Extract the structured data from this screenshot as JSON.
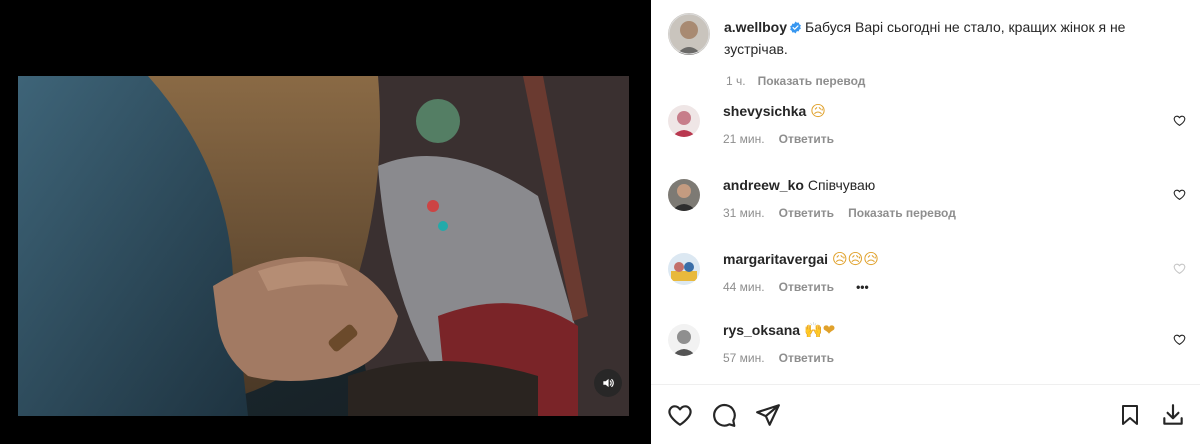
{
  "post": {
    "username": "a.wellboy",
    "caption": "Бабуся Варі сьогодні не стало, кращих жінок я не зустрічав.",
    "time": "1 ч.",
    "translate_label": "Показать перевод"
  },
  "comments": [
    {
      "username": "shevysichka",
      "text": "",
      "emoji": "😥",
      "time": "21 мин.",
      "reply_label": "Ответить"
    },
    {
      "username": "andreew_ko",
      "text": "Співчуваю",
      "emoji": "",
      "time": "31 мин.",
      "reply_label": "Ответить",
      "translate_label": "Показать перевод"
    },
    {
      "username": "margaritavergai",
      "text": "",
      "emoji": "😥😥😥",
      "time": "44 мин.",
      "reply_label": "Ответить",
      "more_label": "•••"
    },
    {
      "username": "rys_oksana",
      "text": "",
      "emoji": "🙌❤",
      "time": "57 мин.",
      "reply_label": "Ответить"
    }
  ],
  "icons": {
    "like": "heart-icon",
    "comment": "comment-icon",
    "share": "share-icon",
    "save": "bookmark-icon",
    "download": "download-icon",
    "mute": "speaker-icon",
    "verified": "verified-badge-icon"
  },
  "colors": {
    "verified": "#3897f0",
    "muted_text": "#8e8e8e",
    "text": "#262626"
  }
}
